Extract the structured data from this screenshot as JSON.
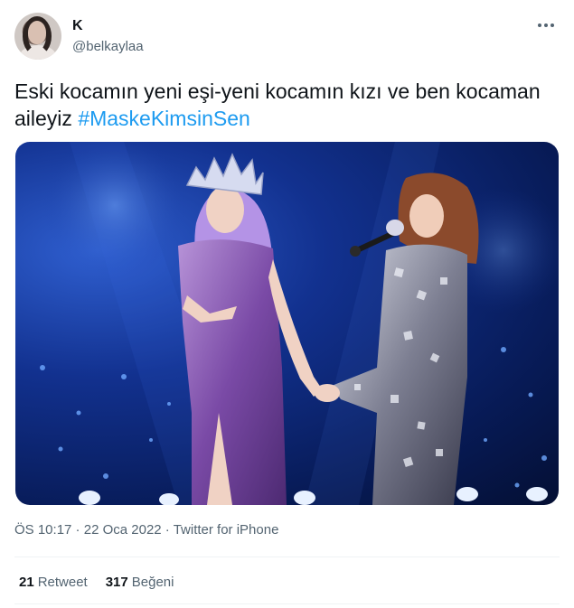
{
  "tweet": {
    "author": {
      "name": "K",
      "handle": "@belkaylaa"
    },
    "more_icon": "more-horizontal-icon",
    "text": {
      "body": "Eski kocamın yeni eşi-yeni kocamın kızı ve ben kocaman aileyiz ",
      "hashtag": "#MaskeKimsinSen"
    },
    "meta": {
      "time": "ÖS 10:17",
      "separator1": " · ",
      "date": "22 Oca 2022",
      "separator2": " · ",
      "source": "Twitter for iPhone"
    },
    "stats": {
      "retweets_count": "21",
      "retweets_label": "Retweet",
      "likes_count": "317",
      "likes_label": "Beğeni"
    },
    "colors": {
      "link": "#1d9bf0",
      "secondary_text": "#536471",
      "primary_text": "#0f1419"
    }
  }
}
